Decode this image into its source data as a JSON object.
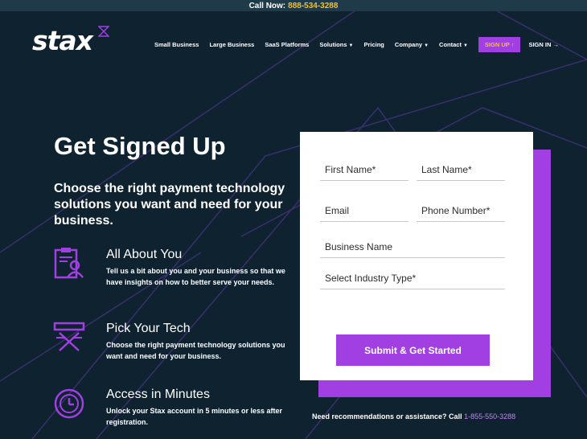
{
  "topbar": {
    "call_label": "Call Now:",
    "phone": "888-534-3288"
  },
  "brand": {
    "logo_text": "stax",
    "accent": "#a23fe3",
    "highlight": "#f2c12e"
  },
  "nav": {
    "items": [
      {
        "label": "Small Business",
        "has_caret": false
      },
      {
        "label": "Large Business",
        "has_caret": false
      },
      {
        "label": "SaaS Platforms",
        "has_caret": false
      },
      {
        "label": "Solutions",
        "has_caret": true
      },
      {
        "label": "Pricing",
        "has_caret": false
      },
      {
        "label": "Company",
        "has_caret": true
      },
      {
        "label": "Contact",
        "has_caret": true
      }
    ],
    "signup_label": "SIGN UP ↑",
    "signin_label": "SIGN IN →"
  },
  "hero": {
    "title": "Get Signed Up",
    "subtitle": "Choose the right payment technology solutions you want and need for your business."
  },
  "features": [
    {
      "icon": "clipboard-user-icon",
      "title": "All About You",
      "desc": "Tell us a bit about you and your business so that we have insights on how to better serve your needs."
    },
    {
      "icon": "tech-stack-icon",
      "title": "Pick Your Tech",
      "desc": "Choose the right payment technology solutions you want and need for your business."
    },
    {
      "icon": "clock-icon",
      "title": "Access in Minutes",
      "desc": "Unlock your Stax account in 5 minutes or less after registration."
    }
  ],
  "form": {
    "first_name": {
      "placeholder": "First Name*",
      "value": ""
    },
    "last_name": {
      "placeholder": "Last Name*",
      "value": ""
    },
    "email": {
      "placeholder": "Email",
      "value": ""
    },
    "phone": {
      "placeholder": "Phone Number*",
      "value": ""
    },
    "business_name": {
      "placeholder": "Business Name",
      "value": ""
    },
    "industry": {
      "placeholder": "Select Industry Type*",
      "value": ""
    },
    "submit_label": "Submit & Get Started"
  },
  "assist": {
    "text": "Need recommendations or assistance? Call",
    "phone": "1-855-550-3288"
  }
}
